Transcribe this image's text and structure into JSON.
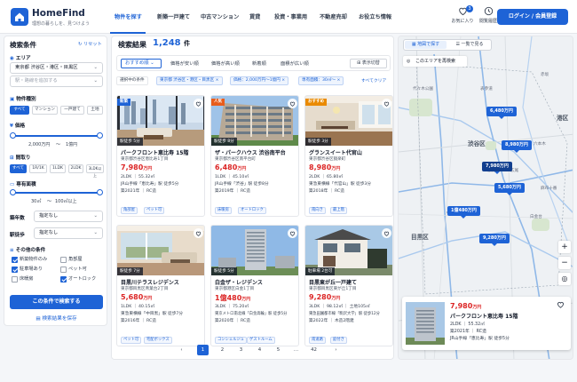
{
  "brand": {
    "name": "HomeFind",
    "tagline": "理想の暮らしを、見つけよう"
  },
  "nav": {
    "items": [
      "物件を探す",
      "新築一戸建て",
      "中古マンション",
      "賃貸",
      "投資・事業用",
      "不動産売却",
      "お役立ち情報"
    ]
  },
  "header": {
    "fav_label": "お気に入り",
    "fav_count": "3",
    "history_label": "閲覧履歴",
    "login_label": "ログイン / 会員登録"
  },
  "sidebar": {
    "title": "検索条件",
    "reset": "リセット",
    "area_label": "エリア",
    "area_value": "東京都 渋谷区・港区・目黒区",
    "station_placeholder": "駅・路線を追加する",
    "type_label": "物件種別",
    "types": [
      "すべて",
      "マンション",
      "一戸建て",
      "土地"
    ],
    "price_label": "価格",
    "price_min": "2,000万円",
    "price_max": "1億円",
    "layout_label": "間取り",
    "layouts": [
      "すべて",
      "1R/1K",
      "1LDK",
      "2LDK",
      "3LDK以上"
    ],
    "size_label": "専有面積",
    "size_min": "30㎡",
    "size_max": "100㎡以上",
    "age_label": "築年数",
    "age_value": "指定なし",
    "walk_label": "駅徒歩",
    "walk_value": "指定なし",
    "other_label": "その他の条件",
    "options": [
      {
        "label": "新築物件のみ",
        "checked": true
      },
      {
        "label": "角部屋",
        "checked": false
      },
      {
        "label": "駐車場あり",
        "checked": true
      },
      {
        "label": "ペット可",
        "checked": false
      },
      {
        "label": "床暖房",
        "checked": false
      },
      {
        "label": "オートロック",
        "checked": true
      }
    ],
    "search_button": "この条件で検索する",
    "save_button": "検索結果を保存"
  },
  "results": {
    "title": "検索結果",
    "count": "1,248",
    "count_unit": "件",
    "sorts": [
      "おすすめ順",
      "価格が安い順",
      "価格が高い順",
      "新着順",
      "面積が広い順"
    ],
    "display_toggle": "表示切替",
    "filters": [
      "選択中の条件",
      "東京都 渋谷区・港区・目黒区",
      "価格：2,000万円〜1億円",
      "専有面積：30㎡〜"
    ],
    "clear_all": "すべてクリア",
    "listings": [
      {
        "name": "パークフロント恵比寿 15階",
        "address": "東京都渋谷区恵比寿1丁目",
        "price": "7,980",
        "unit": "万円",
        "spec": "2LDK ｜ 55.32㎡",
        "access": "JR山手線「恵比寿」駅 徒歩5分",
        "built": "築2021年 ｜ RC造",
        "tags": [
          "角部屋",
          "ペット可"
        ],
        "walk": "駅徒歩 5分",
        "badge": "新築",
        "badge_color": "#1e63d6"
      },
      {
        "name": "ザ・パークハウス 渋谷南平台",
        "address": "東京都渋谷区南平台町",
        "price": "6,480",
        "unit": "万円",
        "spec": "1LDK ｜ 45.10㎡",
        "access": "JR山手線「渋谷」駅 徒歩8分",
        "built": "築2019年 ｜ RC造",
        "tags": [
          "床暖房",
          "オートロック"
        ],
        "walk": "駅徒歩 8分",
        "badge": "人気",
        "badge_color": "#e85d1c"
      },
      {
        "name": "グランスイート代官山",
        "address": "東京都渋谷区猿楽町",
        "price": "8,980",
        "unit": "万円",
        "spec": "2LDK ｜ 65.80㎡",
        "access": "東急東横線「代官山」駅 徒歩3分",
        "built": "築2018年 ｜ RC造",
        "tags": [
          "南向き",
          "最上階"
        ],
        "walk": "駅徒歩 3分",
        "badge": "おすすめ",
        "badge_color": "#ea8a00"
      },
      {
        "name": "目黒川テラスレジデンス",
        "address": "東京都目黒区青葉台2丁目",
        "price": "5,680",
        "unit": "万円",
        "spec": "1LDK ｜ 40.15㎡",
        "access": "東急東横線「中目黒」駅 徒歩7分",
        "built": "築2016年 ｜ RC造",
        "tags": [
          "ペット可",
          "宅配ボックス"
        ],
        "walk": "駅徒歩 7分",
        "badge": "",
        "badge_color": ""
      },
      {
        "name": "白金ザ・レジデンス",
        "address": "東京都港区白金1丁目",
        "price": "1億480",
        "unit": "万円",
        "spec": "3LDK ｜ 75.20㎡",
        "access": "東京メトロ南北線「白金高輪」駅 徒歩5分",
        "built": "築2020年 ｜ RC造",
        "tags": [
          "コンシェルジュ",
          "ゲストルーム"
        ],
        "walk": "駅徒歩 5分",
        "badge": "",
        "badge_color": ""
      },
      {
        "name": "目黒東が丘一戸建て",
        "address": "東京都目黒区東が丘1丁目",
        "price": "9,280",
        "unit": "万円",
        "spec": "3LDK ｜ 98.12㎡ ｜ 土地105㎡",
        "access": "東急田園都市線「駒沢大学」駅 徒歩12分",
        "built": "築2022年 ｜ 木造2階建",
        "tags": [
          "南道路",
          "庭付き"
        ],
        "walk": "駐車場 2台可",
        "badge": "",
        "badge_color": ""
      }
    ],
    "pages": [
      "1",
      "2",
      "3",
      "4",
      "5",
      "…",
      "42"
    ]
  },
  "map": {
    "tab_map": "地図で探す",
    "tab_list": "一覧で見る",
    "area_search": "このエリアを再検索",
    "labels": [
      "渋谷区",
      "港区",
      "目黒区",
      "代々木公園",
      "表参道",
      "六本木",
      "広尾",
      "恵比寿",
      "中目黒",
      "麻布十番",
      "白金台",
      "赤坂"
    ],
    "pins": [
      "6,480万円",
      "8,980万円",
      "7,980万円",
      "5,680万円",
      "1億480万円",
      "9,280万円"
    ],
    "popup": {
      "price": "7,980",
      "unit": "万円",
      "name": "パークフロント恵比寿 15階",
      "spec": "2LDK ｜ 55.32㎡",
      "built": "築2021年 ｜ RC造",
      "access": "JR山手線「恵比寿」駅 徒歩5分"
    }
  },
  "colors": {
    "accent": "#1e63d6",
    "price": "#dc2626"
  }
}
